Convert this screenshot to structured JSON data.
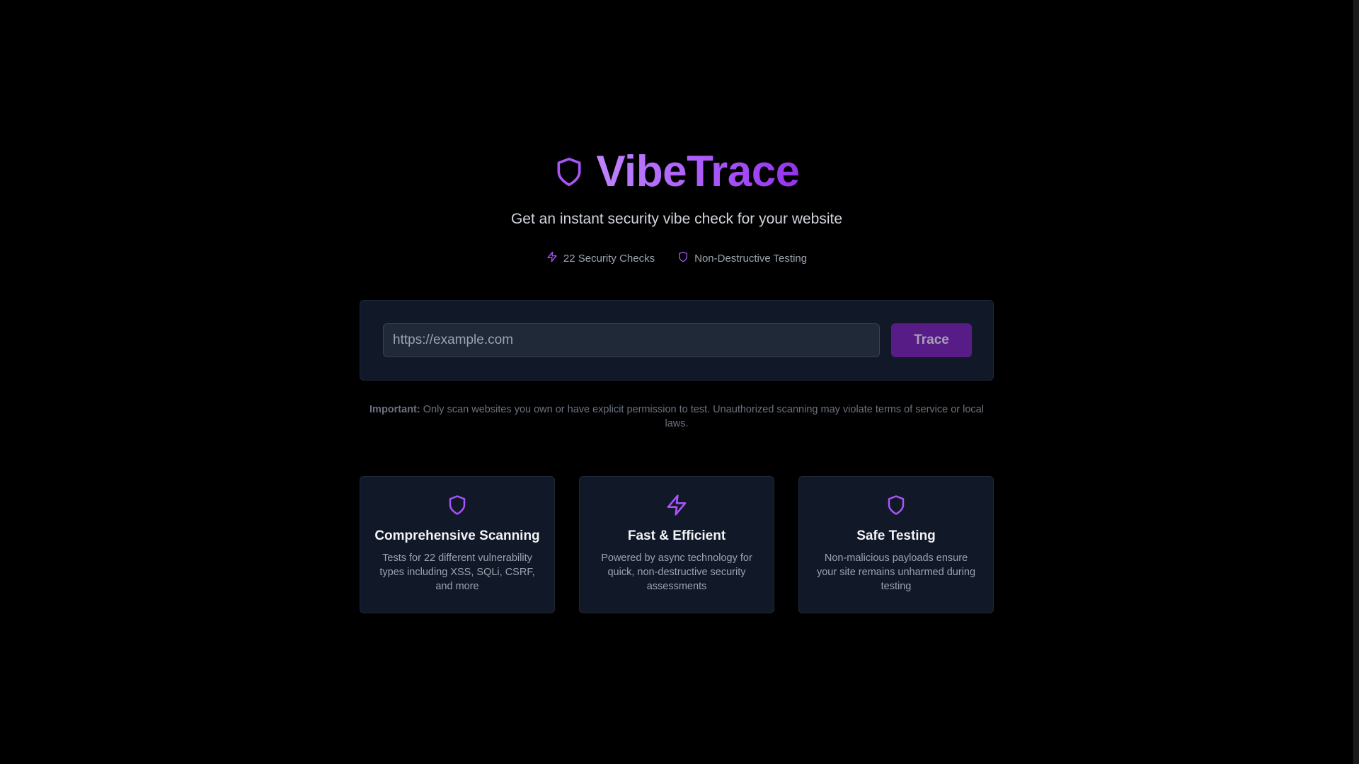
{
  "brand": {
    "title": "VibeTrace",
    "icon": "shield-icon",
    "accent_color": "#a855f7"
  },
  "tagline": "Get an instant security vibe check for your website",
  "highlights": [
    {
      "icon": "lightning-icon",
      "label": "22 Security Checks"
    },
    {
      "icon": "shield-icon",
      "label": "Non-Destructive Testing"
    }
  ],
  "scan": {
    "url_placeholder": "https://example.com",
    "url_value": "",
    "button_label": "Trace"
  },
  "notice": {
    "prefix": "Important:",
    "text": " Only scan websites you own or have explicit permission to test. Unauthorized scanning may violate terms of service or local laws."
  },
  "features": [
    {
      "icon": "shield-icon",
      "title": "Comprehensive Scanning",
      "description": "Tests for 22 different vulnerability types including XSS, SQLi, CSRF, and more"
    },
    {
      "icon": "lightning-icon",
      "title": "Fast & Efficient",
      "description": "Powered by async technology for quick, non-destructive security assessments"
    },
    {
      "icon": "shield-icon",
      "title": "Safe Testing",
      "description": "Non-malicious payloads ensure your site remains unharmed during testing"
    }
  ]
}
